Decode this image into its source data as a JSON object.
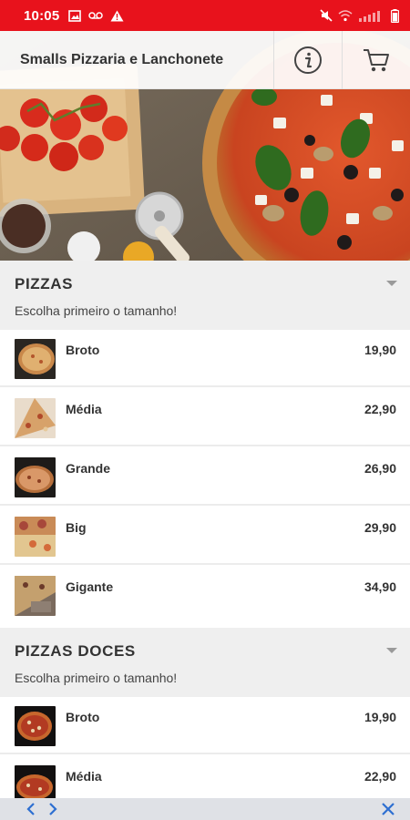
{
  "status_bar": {
    "time": "10:05",
    "left_icons": [
      "image-icon",
      "voicemail-icon",
      "warning-icon"
    ],
    "right_icons": [
      "mute-icon",
      "wifi-icon",
      "signal-icon",
      "battery-icon"
    ]
  },
  "header": {
    "title": "Smalls Pizzaria e Lanchonete",
    "info_icon": "info-icon",
    "cart_icon": "cart-icon"
  },
  "sections": [
    {
      "title": "PIZZAS",
      "subtitle": "Escolha primeiro o tamanho!",
      "items": [
        {
          "name": "Broto",
          "price": "19,90"
        },
        {
          "name": "Média",
          "price": "22,90"
        },
        {
          "name": "Grande",
          "price": "26,90"
        },
        {
          "name": "Big",
          "price": "29,90"
        },
        {
          "name": "Gigante",
          "price": "34,90"
        }
      ]
    },
    {
      "title": "PIZZAS DOCES",
      "subtitle": "Escolha primeiro o tamanho!",
      "items": [
        {
          "name": "Broto",
          "price": "19,90"
        },
        {
          "name": "Média",
          "price": "22,90"
        }
      ]
    }
  ],
  "bottom_bar": {
    "back_icon": "chevron-left-icon",
    "forward_icon": "chevron-right-icon",
    "close_icon": "close-icon"
  },
  "colors": {
    "status_bar": "#e8121c",
    "section_bg": "#efefef",
    "bottom_bar": "#dfe1e6",
    "nav_icons": "#2e6fd1"
  }
}
